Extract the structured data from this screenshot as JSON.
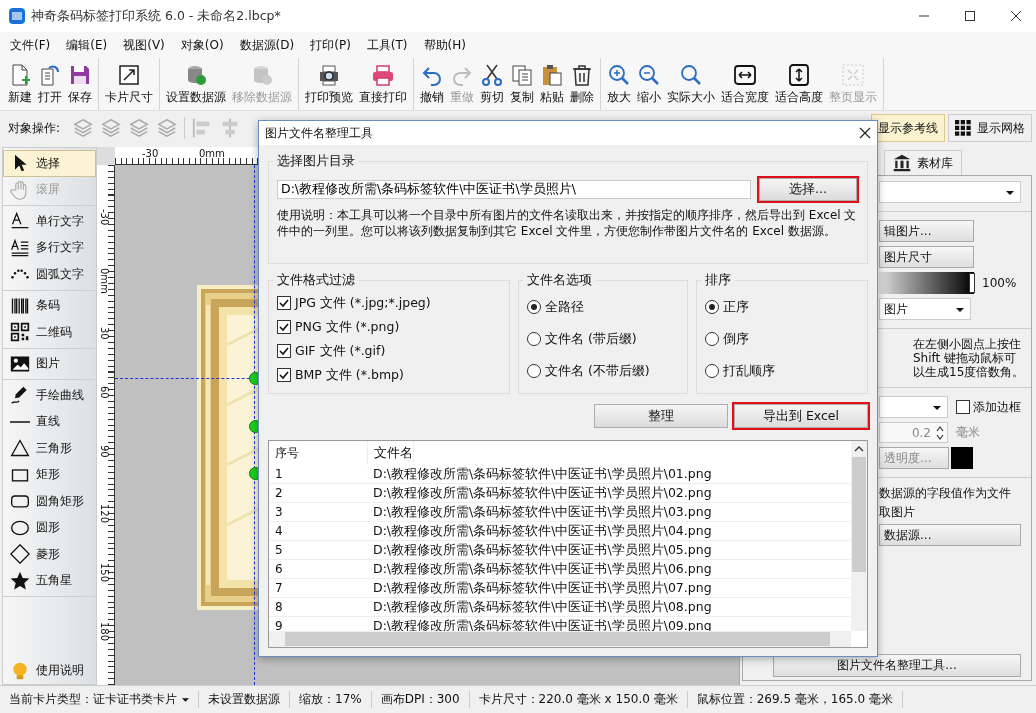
{
  "window": {
    "title": "神奇条码标签打印系统 6.0 - 未命名2.lbcp*"
  },
  "menu": [
    "文件(F)",
    "编辑(E)",
    "视图(V)",
    "对象(O)",
    "数据源(D)",
    "打印(P)",
    "工具(T)",
    "帮助(H)"
  ],
  "toolbar": [
    [
      {
        "label": "新建",
        "disabled": false
      },
      {
        "label": "打开",
        "disabled": false
      },
      {
        "label": "保存",
        "disabled": false
      }
    ],
    [
      {
        "label": "卡片尺寸",
        "disabled": false
      }
    ],
    [
      {
        "label": "设置数据源",
        "disabled": false
      },
      {
        "label": "移除数据源",
        "disabled": true
      }
    ],
    [
      {
        "label": "打印预览",
        "disabled": false
      },
      {
        "label": "直接打印",
        "disabled": false
      }
    ],
    [
      {
        "label": "撤销",
        "disabled": false
      },
      {
        "label": "重做",
        "disabled": true
      },
      {
        "label": "剪切",
        "disabled": false
      },
      {
        "label": "复制",
        "disabled": false
      },
      {
        "label": "粘贴",
        "disabled": false
      },
      {
        "label": "删除",
        "disabled": false
      }
    ],
    [
      {
        "label": "放大",
        "disabled": false
      },
      {
        "label": "缩小",
        "disabled": false
      },
      {
        "label": "实际大小",
        "disabled": false
      },
      {
        "label": "适合宽度",
        "disabled": false
      },
      {
        "label": "适合高度",
        "disabled": false
      },
      {
        "label": "整页显示",
        "disabled": true
      }
    ]
  ],
  "object_bar": {
    "label": "对象操作:",
    "toggles": [
      {
        "label": "显示参考线",
        "selected": true
      },
      {
        "label": "显示网格",
        "selected": false
      }
    ]
  },
  "tools": [
    [
      {
        "label": "选择",
        "selected": true,
        "disabled": false
      },
      {
        "label": "滚屏",
        "selected": false,
        "disabled": true
      }
    ],
    [
      {
        "label": "单行文字",
        "selected": false,
        "disabled": false
      },
      {
        "label": "多行文字",
        "selected": false,
        "disabled": false
      },
      {
        "label": "圆弧文字",
        "selected": false,
        "disabled": false
      }
    ],
    [
      {
        "label": "条码",
        "selected": false,
        "disabled": false
      },
      {
        "label": "二维码",
        "selected": false,
        "disabled": false
      }
    ],
    [
      {
        "label": "图片",
        "selected": false,
        "disabled": false
      }
    ],
    [
      {
        "label": "手绘曲线",
        "selected": false,
        "disabled": false
      },
      {
        "label": "直线",
        "selected": false,
        "disabled": false
      },
      {
        "label": "三角形",
        "selected": false,
        "disabled": false
      },
      {
        "label": "矩形",
        "selected": false,
        "disabled": false
      },
      {
        "label": "圆角矩形",
        "selected": false,
        "disabled": false
      },
      {
        "label": "圆形",
        "selected": false,
        "disabled": false
      },
      {
        "label": "菱形",
        "selected": false,
        "disabled": false
      },
      {
        "label": "五角星",
        "selected": false,
        "disabled": false
      }
    ]
  ],
  "help": "使用说明",
  "rulers": {
    "horizontal": [
      "-30",
      "0mm"
    ],
    "vertical": [
      "-30",
      "0mm",
      "30",
      "60",
      "90",
      "120",
      "150",
      "180"
    ]
  },
  "right_panel": {
    "tab": "素材库",
    "edit_image_button": "辑图片...",
    "image_size_button": "图片尺寸",
    "opacity": {
      "level": 1,
      "reading": "100%"
    },
    "fill_select": "图片",
    "hint": "在左侧小圆点上按住 Shift 键拖动鼠标可以生成15度倍数角。",
    "border_checkbox": {
      "label": "添加边框",
      "checked": false
    },
    "border_width": {
      "value": "0.2",
      "unit": "毫米"
    },
    "transparency_button": "透明度...",
    "datasource_note": [
      "数据源的字段值作为文件",
      "取图片"
    ],
    "datasource_button": "数据源...",
    "tool_button": "图片文件名整理工具..."
  },
  "dialog": {
    "title": "图片文件名整理工具",
    "folder_group": {
      "title": "选择图片目录",
      "path": "D:\\教程修改所需\\条码标签软件\\中医证书\\学员照片\\",
      "browse_button": {
        "label": "选择...",
        "highlighted": true
      },
      "instructions": "使用说明：本工具可以将一个目录中所有图片的文件名读取出来，并按指定的顺序排序，然后导出到 Excel 文件中的一列里。您可以将该列数据复制到其它 Excel 文件里，方便您制作带图片文件名的 Excel 数据源。"
    },
    "format_filter": {
      "title": "文件格式过滤",
      "options": [
        {
          "label": "JPG 文件 (*.jpg;*.jpeg)",
          "checked": true
        },
        {
          "label": "PNG 文件 (*.png)",
          "checked": true
        },
        {
          "label": "GIF 文件 (*.gif)",
          "checked": true
        },
        {
          "label": "BMP 文件 (*.bmp)",
          "checked": true
        }
      ]
    },
    "name_options": {
      "title": "文件名选项",
      "options": [
        {
          "label": "全路径",
          "selected": true
        },
        {
          "label": "文件名 (带后缀)",
          "selected": false
        },
        {
          "label": "文件名 (不带后缀)",
          "selected": false
        }
      ]
    },
    "sort": {
      "title": "排序",
      "options": [
        {
          "label": "正序",
          "selected": true
        },
        {
          "label": "倒序",
          "selected": false
        },
        {
          "label": "打乱顺序",
          "selected": false
        }
      ]
    },
    "actions": [
      {
        "label": "整理",
        "highlighted": false
      },
      {
        "label": "导出到 Excel",
        "highlighted": true
      }
    ],
    "table": {
      "columns": [
        "序号",
        "文件名"
      ],
      "rows": [
        [
          "1",
          "D:\\教程修改所需\\条码标签软件\\中医证书\\学员照片\\01.png"
        ],
        [
          "2",
          "D:\\教程修改所需\\条码标签软件\\中医证书\\学员照片\\02.png"
        ],
        [
          "3",
          "D:\\教程修改所需\\条码标签软件\\中医证书\\学员照片\\03.png"
        ],
        [
          "4",
          "D:\\教程修改所需\\条码标签软件\\中医证书\\学员照片\\04.png"
        ],
        [
          "5",
          "D:\\教程修改所需\\条码标签软件\\中医证书\\学员照片\\05.png"
        ],
        [
          "6",
          "D:\\教程修改所需\\条码标签软件\\中医证书\\学员照片\\06.png"
        ],
        [
          "7",
          "D:\\教程修改所需\\条码标签软件\\中医证书\\学员照片\\07.png"
        ],
        [
          "8",
          "D:\\教程修改所需\\条码标签软件\\中医证书\\学员照片\\08.png"
        ],
        [
          "9",
          "D:\\教程修改所需\\条码标签软件\\中医证书\\学员照片\\09.png"
        ]
      ]
    }
  },
  "status_bar": [
    {
      "kind": "dropdown",
      "text": "当前卡片类型：证卡证书类卡片"
    },
    {
      "kind": "text",
      "text": "未设置数据源"
    },
    {
      "kind": "text",
      "text": "缩放：17%"
    },
    {
      "kind": "text",
      "text": "画布DPI：300"
    },
    {
      "kind": "text",
      "text": "卡片尺寸：220.0 毫米 x 150.0 毫米"
    },
    {
      "kind": "text",
      "text": "鼠标位置：269.5 毫米，165.0 毫米"
    }
  ]
}
